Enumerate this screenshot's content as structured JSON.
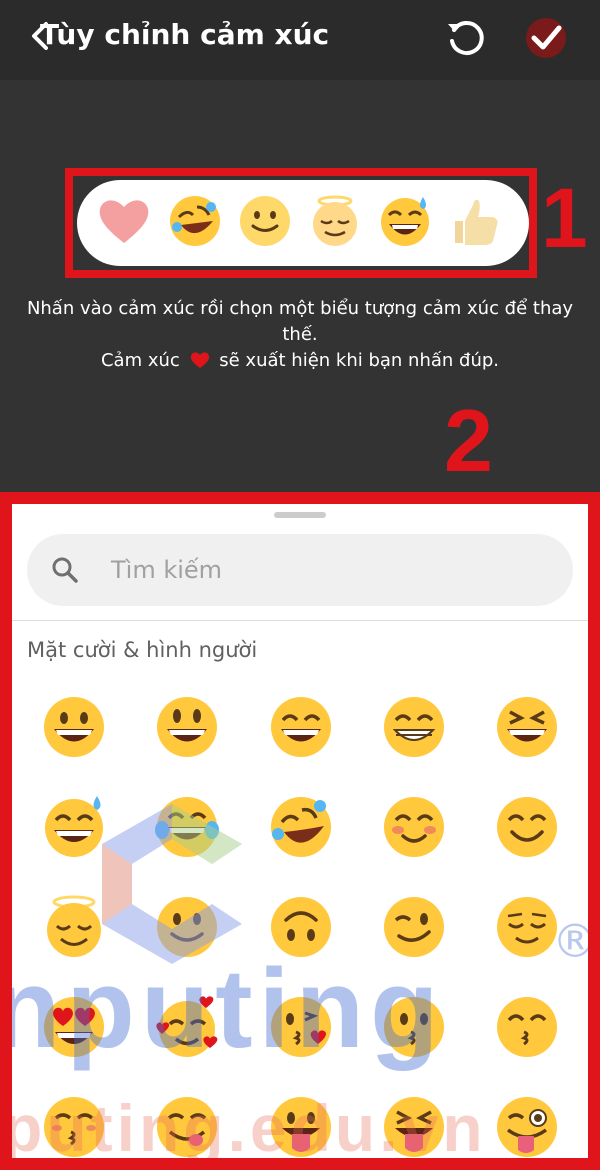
{
  "header": {
    "title": "Tùy chỉnh cảm xúc"
  },
  "reactions": [
    "heart-icon",
    "rofl-emoji-icon",
    "slight-smile-emoji-icon",
    "relieved-emoji-icon",
    "sweat-smile-emoji-icon",
    "thumbs-up-icon"
  ],
  "annotations": {
    "one": "1",
    "two": "2"
  },
  "instructions": {
    "line1": "Nhấn vào cảm xúc rồi chọn một biểu tượng cảm xúc để thay thế.",
    "line2_before": "Cảm xúc",
    "line2_after": "sẽ xuất hiện khi bạn nhấn đúp."
  },
  "search": {
    "placeholder": "Tìm kiếm"
  },
  "section_title": "Mặt cười & hình người",
  "watermark": {
    "big": "nputing",
    "small": "puting.edu.vn",
    "reg": "®"
  },
  "colors": {
    "accent": "#e0141b",
    "emoji_yellow": "#ffc83d",
    "dark": "#333333"
  }
}
